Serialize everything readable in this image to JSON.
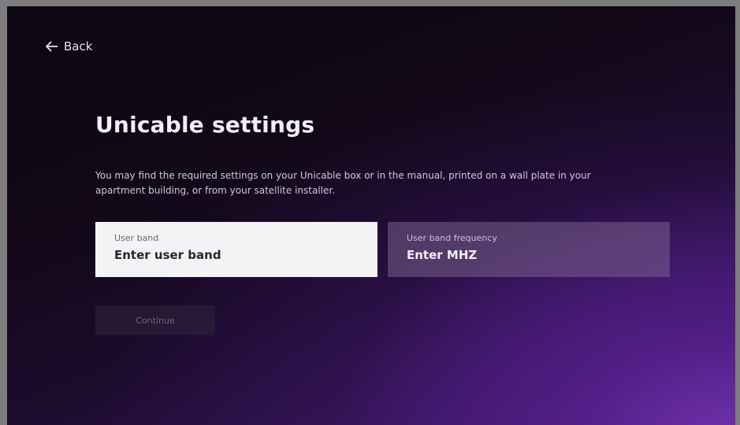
{
  "nav": {
    "back_label": "Back",
    "back_icon": "arrow-left-icon"
  },
  "page": {
    "title": "Unicable settings",
    "description": "You may find the required settings on your Unicable box or in the manual, printed on a wall plate in your apartment building, or from your satellite installer."
  },
  "fields": {
    "user_band": {
      "label": "User band",
      "placeholder": "Enter user band"
    },
    "user_band_frequency": {
      "label": "User band frequency",
      "placeholder": "Enter MHZ"
    }
  },
  "actions": {
    "continue_label": "Continue"
  },
  "colors": {
    "background_dark": "#0d0613",
    "background_purple": "#7634b2",
    "focused_field": "#f3f2f4",
    "unfocused_field": "#6a5580"
  }
}
